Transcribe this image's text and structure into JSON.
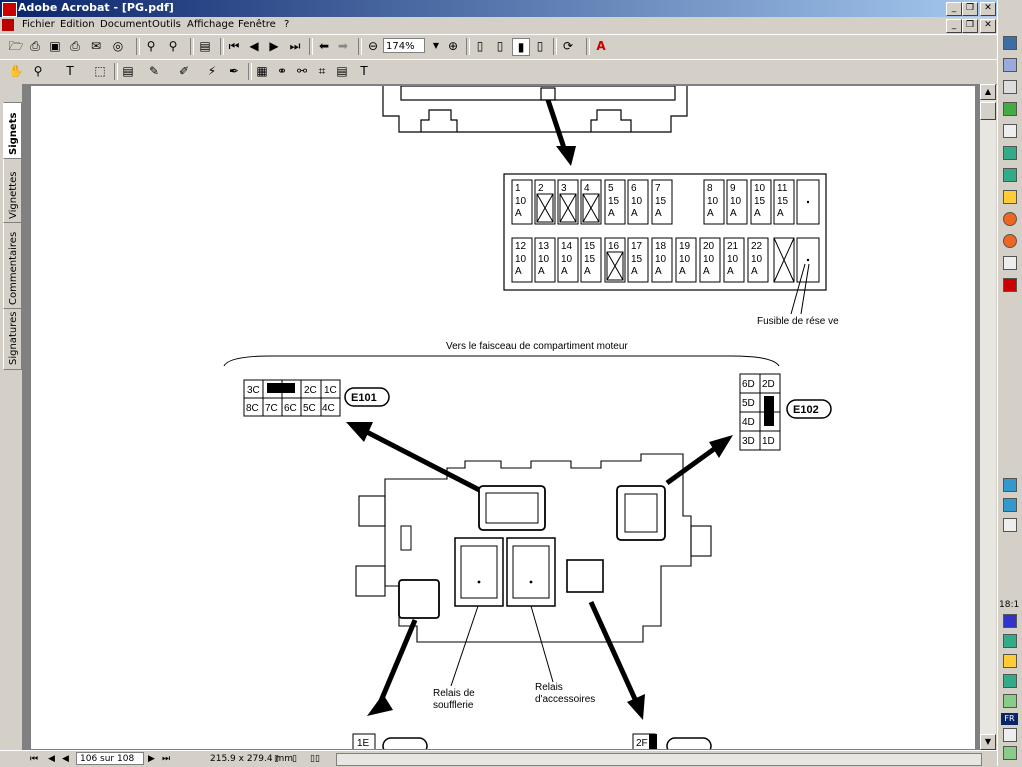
{
  "window": {
    "title": "Adobe Acrobat - [PG.pdf]"
  },
  "menu": [
    "Fichier",
    "Edition",
    "Document",
    "Outils",
    "Affichage",
    "Fenêtre",
    "?"
  ],
  "toolbar": {
    "zoom": "174%"
  },
  "nav_tabs": [
    "Signets",
    "Vignettes",
    "Commentaires",
    "Signatures"
  ],
  "status": {
    "page": "106 sur 108",
    "size": "215.9 x 279.4 mm"
  },
  "tray": {
    "res": "18:1",
    "lang": "FR"
  },
  "doc": {
    "fuse_row1": [
      {
        "n": "1",
        "v": "10",
        "u": "A"
      },
      {
        "n": "2",
        "x": true
      },
      {
        "n": "3",
        "x": true
      },
      {
        "n": "4",
        "x": true
      },
      {
        "n": "5",
        "v": "15",
        "u": "A"
      },
      {
        "n": "6",
        "v": "10",
        "u": "A"
      },
      {
        "n": "7",
        "v": "15",
        "u": "A"
      },
      {
        "n": "8",
        "v": "10",
        "u": "A"
      },
      {
        "n": "9",
        "v": "10",
        "u": "A"
      },
      {
        "n": "10",
        "v": "15",
        "u": "A"
      },
      {
        "n": "11",
        "v": "15",
        "u": "A"
      }
    ],
    "fuse_row2": [
      {
        "n": "12",
        "v": "10",
        "u": "A"
      },
      {
        "n": "13",
        "v": "10",
        "u": "A"
      },
      {
        "n": "14",
        "v": "10",
        "u": "A"
      },
      {
        "n": "15",
        "v": "15",
        "u": "A"
      },
      {
        "n": "16",
        "x": true
      },
      {
        "n": "17",
        "v": "15",
        "u": "A"
      },
      {
        "n": "18",
        "v": "10",
        "u": "A"
      },
      {
        "n": "19",
        "v": "10",
        "u": "A"
      },
      {
        "n": "20",
        "v": "10",
        "u": "A"
      },
      {
        "n": "21",
        "v": "10",
        "u": "A"
      },
      {
        "n": "22",
        "v": "10",
        "u": "A"
      }
    ],
    "spare_label": "Fusible de rése ve",
    "harness_label": "Vers le faisceau de compartiment moteur",
    "e101": {
      "id": "E101",
      "row1": [
        "3C",
        "",
        "2C",
        "1C"
      ],
      "row2": [
        "8C",
        "7C",
        "6C",
        "5C",
        "4C"
      ]
    },
    "e102": {
      "id": "E102",
      "pins": [
        "6D",
        "2D",
        "5D",
        "4D",
        "3D",
        "1D"
      ]
    },
    "relay1": [
      "Relais de",
      "soufflerie"
    ],
    "relay2": [
      "Relais",
      "d'accessoires"
    ],
    "bottom_left": "1E",
    "bottom_right": "2F"
  }
}
